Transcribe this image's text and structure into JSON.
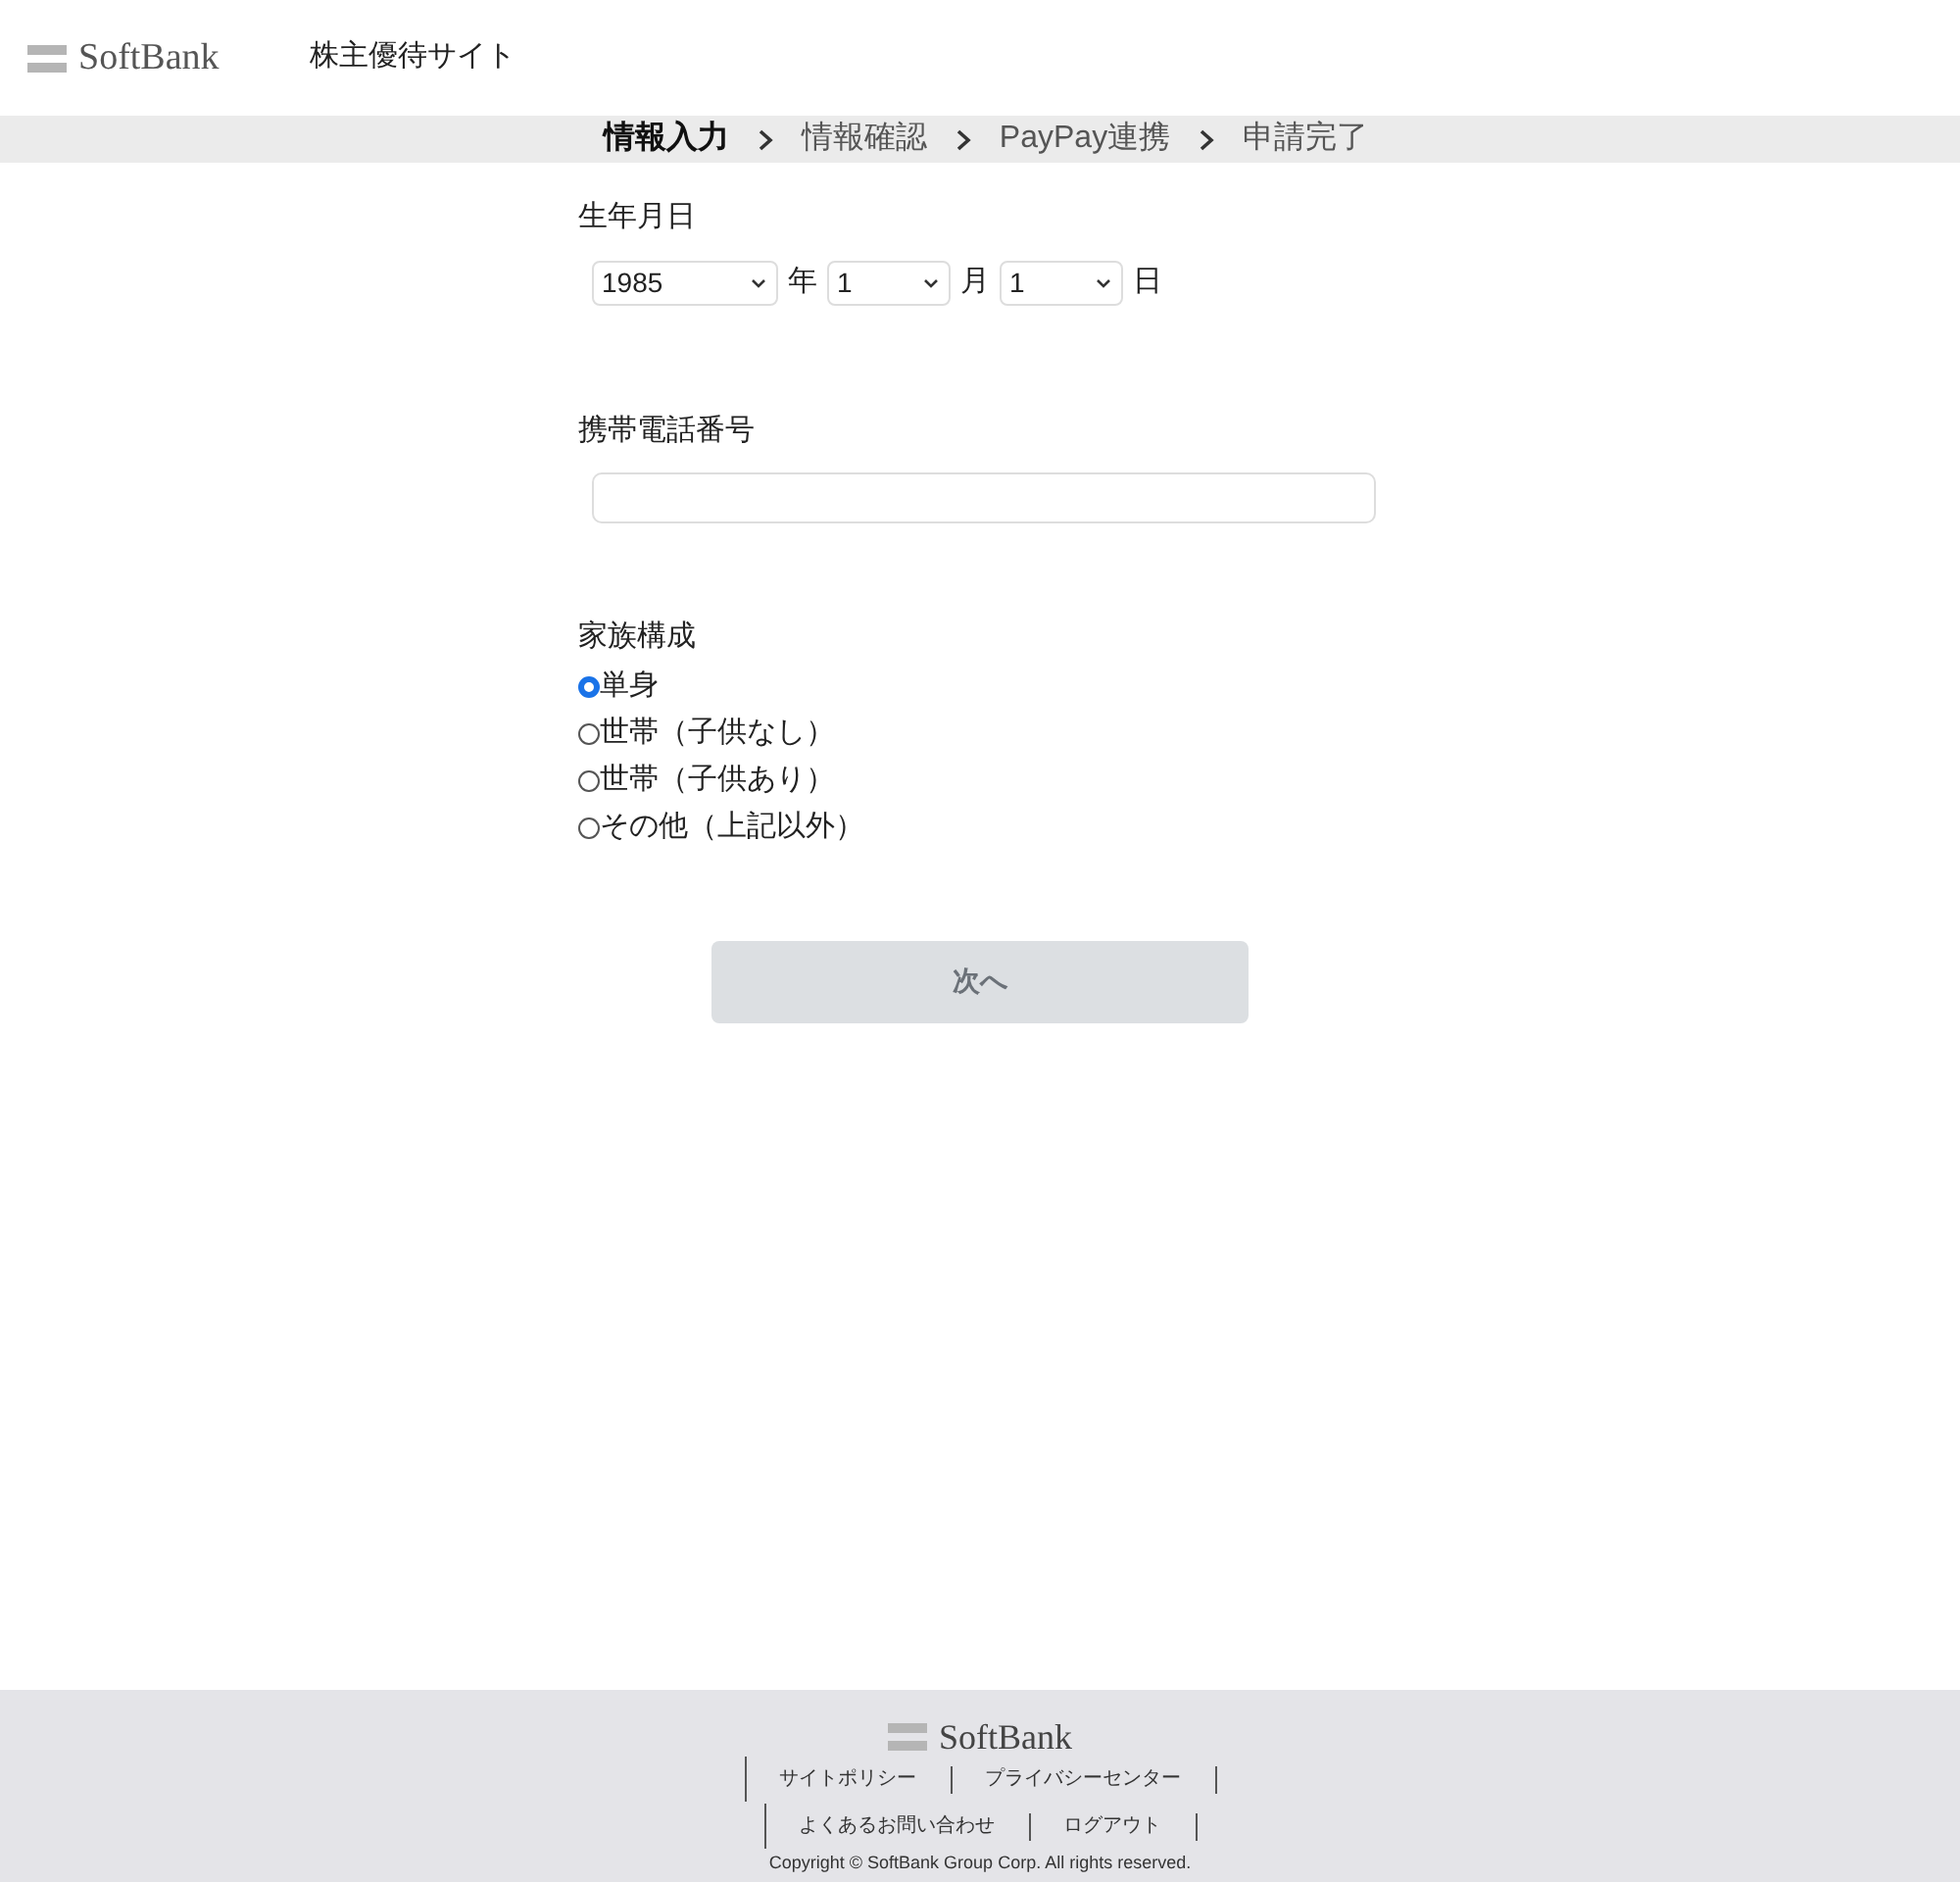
{
  "header": {
    "logo": "SoftBank",
    "site_title": "株主優待サイト"
  },
  "steps": [
    {
      "label": "情報入力",
      "selected": true
    },
    {
      "label": "情報確認",
      "selected": false
    },
    {
      "label": "PayPay連携",
      "selected": false
    },
    {
      "label": "申請完了",
      "selected": false
    }
  ],
  "birthdate": {
    "label": "生年月日",
    "fields": [
      {
        "value": "1985",
        "suffix": "年"
      },
      {
        "value": "1",
        "suffix": "月"
      },
      {
        "value": "1",
        "suffix": "日"
      }
    ]
  },
  "phone": {
    "label": "携帯電話番号"
  },
  "family": {
    "label": "家族構成",
    "options": [
      {
        "label": "単身",
        "selected": true
      },
      {
        "label": "世帯（子供なし）",
        "selected": false
      },
      {
        "label": "世帯（子供あり）",
        "selected": false
      },
      {
        "label": "その他（上記以外）",
        "selected": false
      }
    ]
  },
  "next_button": {
    "label": "次へ",
    "disabled": true
  },
  "footer": {
    "logo": "SoftBank",
    "link_rows": [
      [
        "サイトポリシー",
        "プライバシーセンター"
      ],
      [
        "よくあるお問い合わせ",
        "ログアウト"
      ]
    ],
    "copyright": "Copyright © SoftBank Group Corp. All rights reserved."
  }
}
